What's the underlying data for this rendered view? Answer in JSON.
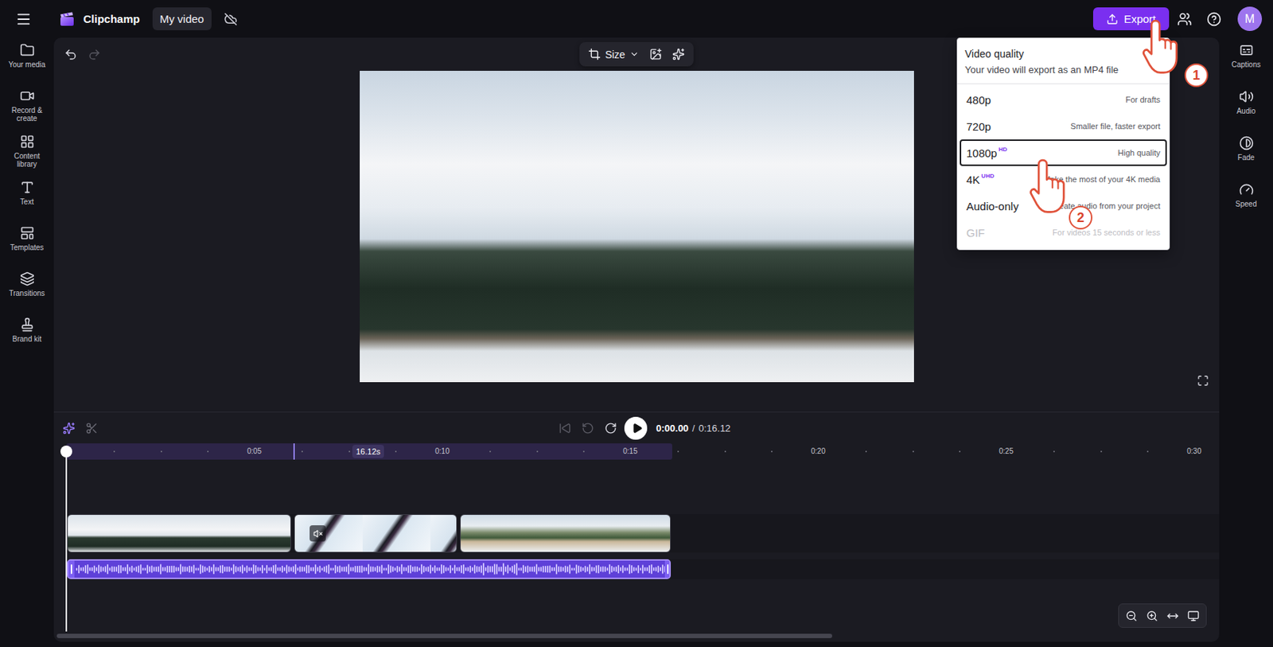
{
  "app": {
    "name": "Clipchamp",
    "project_title": "My video"
  },
  "header": {
    "export_label": "Export",
    "avatar_initial": "M"
  },
  "left_sidebar": {
    "items": [
      {
        "label": "Your media"
      },
      {
        "label": "Record & create"
      },
      {
        "label": "Content library"
      },
      {
        "label": "Text"
      },
      {
        "label": "Templates"
      },
      {
        "label": "Transitions"
      },
      {
        "label": "Brand kit"
      }
    ]
  },
  "right_sidebar": {
    "items": [
      {
        "label": "Captions"
      },
      {
        "label": "Audio"
      },
      {
        "label": "Fade"
      },
      {
        "label": "Speed"
      }
    ]
  },
  "preview_toolbar": {
    "size_label": "Size",
    "undo_disabled": false,
    "redo_disabled": true
  },
  "export_menu": {
    "title": "Video quality",
    "subtitle": "Your video will export as an MP4 file",
    "options": [
      {
        "label": "480p",
        "badge": "",
        "description": "For drafts",
        "selected": false,
        "disabled": false
      },
      {
        "label": "720p",
        "badge": "",
        "description": "Smaller file, faster export",
        "selected": false,
        "disabled": false
      },
      {
        "label": "1080p",
        "badge": "HD",
        "description": "High quality",
        "selected": true,
        "disabled": false
      },
      {
        "label": "4K",
        "badge": "UHD",
        "description": "Make the most of your 4K media",
        "selected": false,
        "disabled": false
      },
      {
        "label": "Audio-only",
        "badge": "",
        "description": "Create audio from your project",
        "selected": false,
        "disabled": false
      },
      {
        "label": "GIF",
        "badge": "",
        "description": "For videos 15 seconds or less",
        "selected": false,
        "disabled": true
      }
    ]
  },
  "timeline": {
    "current_time": "0:00.00",
    "separator": "/",
    "total_time": "0:16.12",
    "skip_back_disabled": true,
    "rewind_disabled": true,
    "ruler_labels": [
      "0:05",
      "0:10",
      "0:15",
      "0:20",
      "0:25",
      "0:30"
    ],
    "hover_label": "16.12s",
    "video_clips": [
      {
        "kind": "mountains",
        "muted": false
      },
      {
        "kind": "skier",
        "muted": true
      },
      {
        "kind": "village",
        "muted": false
      }
    ],
    "audio_clip": {
      "selected": true
    }
  },
  "annotations": [
    {
      "label": "1"
    },
    {
      "label": "2"
    }
  ]
}
